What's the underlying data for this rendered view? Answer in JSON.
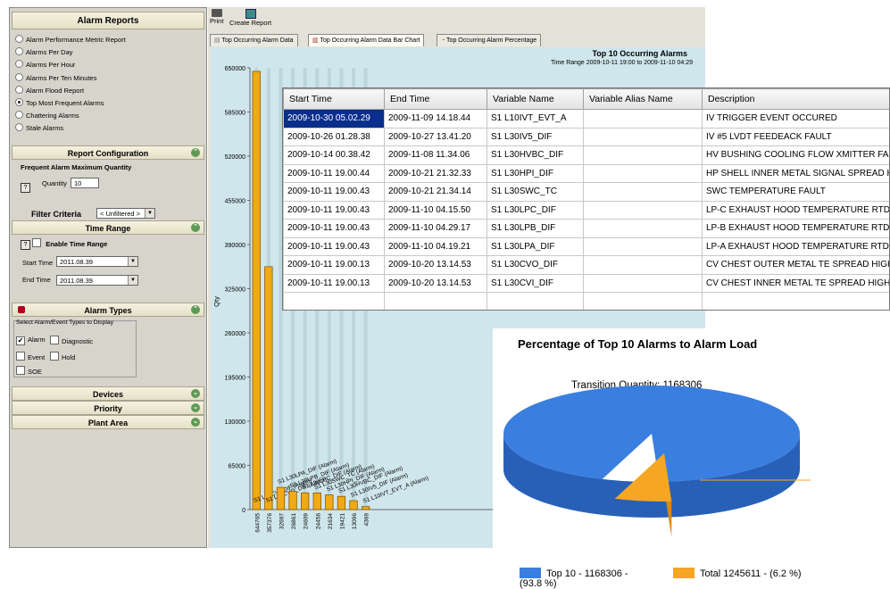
{
  "left_panel": {
    "alarm_reports_title": "Alarm Reports",
    "reports": [
      {
        "label": "Alarm Performance Metric Report",
        "selected": false
      },
      {
        "label": "Alarms Per Day",
        "selected": false
      },
      {
        "label": "Alarms Per Hour",
        "selected": false
      },
      {
        "label": "Alarms Per Ten Minutes",
        "selected": false
      },
      {
        "label": "Alarm Flood Report",
        "selected": false
      },
      {
        "label": "Top Most Frequent Alarms",
        "selected": true
      },
      {
        "label": "Chattering Alarms",
        "selected": false
      },
      {
        "label": "Stale Alarms",
        "selected": false
      }
    ],
    "report_config_title": "Report Configuration",
    "freq_max_qty_label": "Frequent Alarm Maximum Quantity",
    "quantity_label": "Quantity",
    "quantity_value": "10",
    "filter_criteria_label": "Filter Criteria",
    "filter_select": "< Unfiltered >",
    "time_range_title": "Time Range",
    "enable_time_range_label": "Enable Time Range",
    "start_time_label": "Start Time",
    "start_time_value": "2011.08.39",
    "end_time_label": "End Time",
    "end_time_value": "2011.08.39",
    "alarm_types_title": "Alarm Types",
    "select_types_label": "Select Alarm/Event Types to Display",
    "types": [
      {
        "label": "Alarm",
        "checked": true
      },
      {
        "label": "Diagnostic",
        "checked": false
      },
      {
        "label": "Event",
        "checked": false
      },
      {
        "label": "Hold",
        "checked": false
      },
      {
        "label": "SOE",
        "checked": false
      }
    ],
    "devices_title": "Devices",
    "priority_title": "Priority",
    "plant_area_title": "Plant Area"
  },
  "main": {
    "print_label": "Print",
    "create_report_label": "Create Report",
    "tabs": [
      {
        "label": "Top Occurring Alarm Data",
        "active": false
      },
      {
        "label": "Top Occurring Alarm Data Bar Chart",
        "active": true
      },
      {
        "label": "Top Occurring Alarm Percentage",
        "active": false
      }
    ],
    "chart_title": "Top 10 Occurring Alarms",
    "chart_subtitle": "Time Range 2009-10-11 19:00 to 2009-11-10 04:29"
  },
  "chart_data": {
    "type": "bar",
    "ylabel": "Qty",
    "ylim": [
      0,
      650000
    ],
    "yticks": [
      "0",
      "65000",
      "130000",
      "195000",
      "260000",
      "325000",
      "390000",
      "455000",
      "520000",
      "585000",
      "650000"
    ],
    "grid": false,
    "values": [
      644765,
      357376,
      32697,
      26861,
      24609,
      24456,
      21634,
      19421,
      13096,
      4369
    ],
    "value_labels": [
      "644765",
      "357376",
      "32697",
      "26861",
      "24609",
      "24456",
      "21634",
      "19421",
      "13096",
      "4369"
    ],
    "categories": [
      "S1 L10IVT_EVT_A (Alarm)",
      "S1 L30IV5_DIF (Alarm)",
      "S1 L30HVBC_DIF (Alarm)",
      "S1 L30HPI_DIF (Alarm)",
      "S1 L30SWC_TC (Alarm)",
      "S1 L30LPC_DIF (Alarm)",
      "S1 L30LPB_DIF (Alarm)",
      "S1 L30LPA_DIF (Alarm)",
      "S1 L30CVO_DIF (Alarm)",
      "S1 L30CVI_DIF (Alarm)"
    ]
  },
  "table": {
    "columns": [
      "Start Time",
      "End Time",
      "Variable Name",
      "Variable Alias Name",
      "Description"
    ],
    "rows": [
      [
        "2009-10-30 05.02.29",
        "2009-11-09 14.18.44",
        "S1 L10IVT_EVT_A",
        "",
        "IV TRIGGER EVENT OCCURED"
      ],
      [
        "2009-10-26 01.28.38",
        "2009-10-27 13.41.20",
        "S1 L30IV5_DIF",
        "",
        "IV #5 LVDT FEEDEACK FAULT"
      ],
      [
        "2009-10-14 00.38.42",
        "2009-11-08 11.34.06",
        "S1 L30HVBC_DIF",
        "",
        "HV BUSHING COOLING FLOW XMITTER FAULT"
      ],
      [
        "2009-10-11 19.00.44",
        "2009-10-21 21.32.33",
        "S1 L30HPI_DIF",
        "",
        "HP SHELL INNER METAL SIGNAL SPREAD HIGH"
      ],
      [
        "2009-10-11 19.00.43",
        "2009-10-21 21.34.14",
        "S1 L30SWC_TC",
        "",
        "SWC TEMPERATURE FAULT"
      ],
      [
        "2009-10-11 19.00.43",
        "2009-11-10 04.15.50",
        "S1 L30LPC_DIF",
        "",
        "LP-C EXHAUST HOOD TEMPERATURE RTD FAILURE"
      ],
      [
        "2009-10-11 19.00.43",
        "2009-11-10 04.29.17",
        "S1 L30LPB_DIF",
        "",
        "LP-B EXHAUST HOOD TEMPERATURE RTD FAILURE"
      ],
      [
        "2009-10-11 19.00.43",
        "2009-11-10 04.19.21",
        "S1 L30LPA_DIF",
        "",
        "LP-A EXHAUST HOOD TEMPERATURE RTD FAILURE"
      ],
      [
        "2009-10-11 19.00.13",
        "2009-10-20 13.14.53",
        "S1 L30CVO_DIF",
        "",
        "CV CHEST OUTER METAL TE SPREAD HIGH"
      ],
      [
        "2009-10-11 19.00.13",
        "2009-10-20 13.14.53",
        "S1 L30CVI_DIF",
        "",
        "CV CHEST INNER METAL TE SPREAD HIGH"
      ]
    ]
  },
  "pie_chart": {
    "title": "Percentage of Top 10 Alarms to Alarm Load",
    "annotation": "Transition Quantity: 1168306",
    "slices": [
      {
        "label": "Top 10 - 1168306 - (93.8 %)",
        "percent": 93.8,
        "color": "#3a7fe0"
      },
      {
        "label": "Total 1245611 - (6.2 %)",
        "percent": 6.2,
        "color": "#f5a623"
      }
    ]
  },
  "colors": {
    "bar_fill": "#f2a916",
    "bar_stroke": "#8a5a00",
    "selection": "#0a2e8c"
  }
}
